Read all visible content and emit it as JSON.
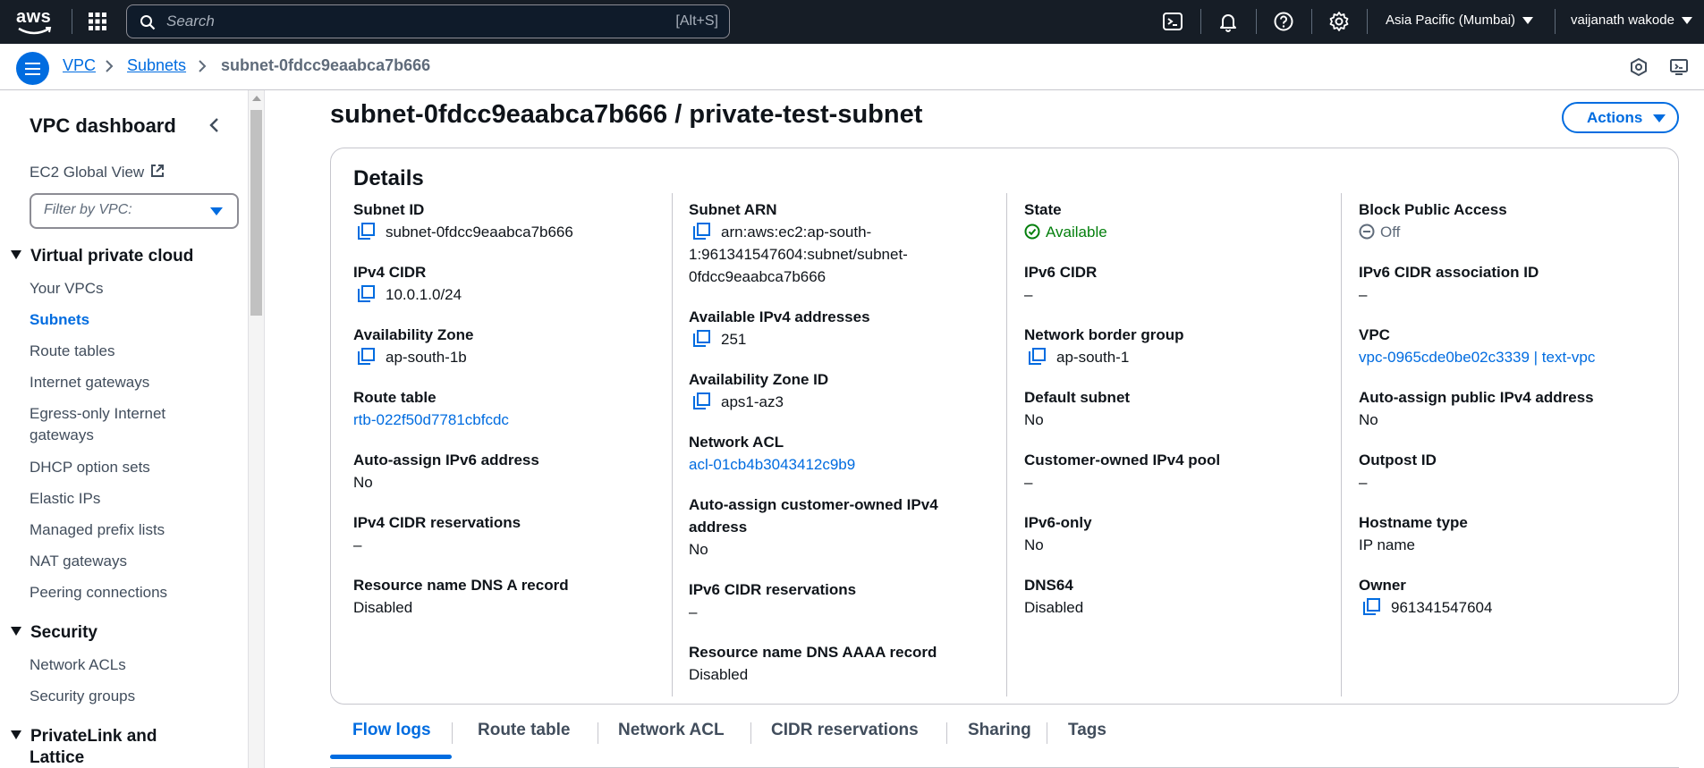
{
  "topnav": {
    "logo_text": "aws",
    "search_placeholder": "Search",
    "search_shortcut": "[Alt+S]",
    "region": "Asia Pacific (Mumbai)",
    "user": "vaijanath wakode",
    "icons": [
      "cloudshell-icon",
      "bell-icon",
      "help-icon",
      "settings-icon"
    ]
  },
  "breadcrumb": {
    "items": [
      "VPC",
      "Subnets",
      "subnet-0fdcc9eaabca7b666"
    ]
  },
  "sidebar": {
    "title": "VPC dashboard",
    "ec2_global_view": "EC2 Global View",
    "filter_placeholder": "Filter by VPC:",
    "section_vpc": "Virtual private cloud",
    "vpc_items": [
      "Your VPCs",
      "Subnets",
      "Route tables",
      "Internet gateways",
      "Egress-only Internet",
      "gateways",
      "DHCP option sets",
      "Elastic IPs",
      "Managed prefix lists",
      "NAT gateways",
      "Peering connections"
    ],
    "section_security": "Security",
    "security_items": [
      "Network ACLs",
      "Security groups"
    ],
    "section_privatelink_line1": "PrivateLink and",
    "section_privatelink_line2": "Lattice"
  },
  "page": {
    "title": "subnet-0fdcc9eaabca7b666 / private-test-subnet",
    "actions": "Actions",
    "details_heading": "Details"
  },
  "details": {
    "col1": [
      {
        "label": "Subnet ID",
        "value": "subnet-0fdcc9eaabca7b666"
      },
      {
        "label": "IPv4 CIDR",
        "value": "10.0.1.0/24"
      },
      {
        "label": "Availability Zone",
        "value": "ap-south-1b"
      },
      {
        "label": "Route table",
        "value": "rtb-022f50d7781cbfcdc"
      },
      {
        "label": "Auto-assign IPv6 address",
        "value": "No"
      },
      {
        "label": "IPv4 CIDR reservations",
        "value": "–"
      },
      {
        "label": "Resource name DNS A record",
        "value": "Disabled"
      }
    ],
    "col2": [
      {
        "label": "Subnet ARN",
        "value_line1": "arn:aws:ec2:ap-south-",
        "value_line2": "1:961341547604:subnet/subnet-",
        "value_line3": "0fdcc9eaabca7b666"
      },
      {
        "label": "Available IPv4 addresses",
        "value": "251"
      },
      {
        "label": "Availability Zone ID",
        "value": "aps1-az3"
      },
      {
        "label": "Network ACL",
        "value": "acl-01cb4b3043412c9b9"
      },
      {
        "label_line1": "Auto-assign customer-owned IPv4",
        "label_line2": "address",
        "value": "No"
      },
      {
        "label": "IPv6 CIDR reservations",
        "value": "–"
      },
      {
        "label": "Resource name DNS AAAA record",
        "value": "Disabled"
      }
    ],
    "col3": [
      {
        "label": "State",
        "value": "Available"
      },
      {
        "label": "IPv6 CIDR",
        "value": "–"
      },
      {
        "label": "Network border group",
        "value": "ap-south-1"
      },
      {
        "label": "Default subnet",
        "value": "No"
      },
      {
        "label": "Customer-owned IPv4 pool",
        "value": "–"
      },
      {
        "label": "IPv6-only",
        "value": "No"
      },
      {
        "label": "DNS64",
        "value": "Disabled"
      }
    ],
    "col4": [
      {
        "label": "Block Public Access",
        "value": "Off"
      },
      {
        "label": "IPv6 CIDR association ID",
        "value": "–"
      },
      {
        "label": "VPC",
        "value": "vpc-0965cde0be02c3339 | text-vpc"
      },
      {
        "label": "Auto-assign public IPv4 address",
        "value": "No"
      },
      {
        "label": "Outpost ID",
        "value": "–"
      },
      {
        "label": "Hostname type",
        "value": "IP name"
      },
      {
        "label": "Owner",
        "value": "961341547604"
      }
    ]
  },
  "tabs": [
    "Flow logs",
    "Route table",
    "Network ACL",
    "CIDR reservations",
    "Sharing",
    "Tags"
  ],
  "colors": {
    "accent": "#006ce0",
    "nav_bg": "#161d26",
    "success": "#037f0c"
  }
}
